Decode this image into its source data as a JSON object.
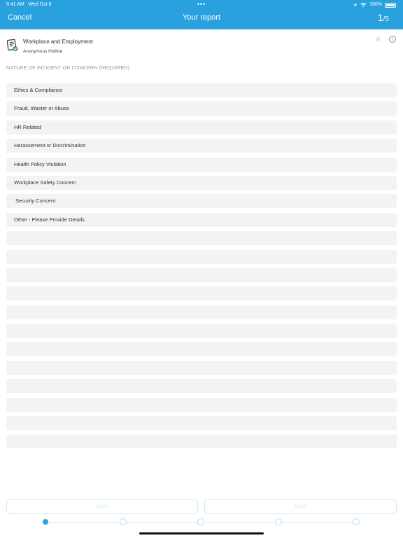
{
  "status": {
    "time": "9:41 AM",
    "date": "Wed Oct 6",
    "battery": "100%"
  },
  "nav": {
    "cancel": "Cancel",
    "title": "Your report",
    "step_current": "1",
    "step_total": "/5"
  },
  "header": {
    "name": "Workplace and Employment",
    "sub": "Anonymous Hotline"
  },
  "section_label": "NATURE OF INCIDENT OR CONCERN (REQUIRED)",
  "options": [
    "Ethics & Compliance",
    "Fraud, Waster or Abuse",
    "HR Related",
    "Harassement or Discrimination",
    "Health Policy Violation",
    "Workplace Safety Concern",
    " Security Concern",
    "Other - Please Provide Details",
    "",
    "",
    "",
    "",
    "",
    "",
    "",
    "",
    "",
    "",
    "",
    ""
  ],
  "footer": {
    "back": "Back",
    "next": "Next"
  },
  "progress": {
    "steps": 5,
    "current": 1
  },
  "colors": {
    "brand": "#2aa1df",
    "row_bg": "#f2f3f5"
  }
}
